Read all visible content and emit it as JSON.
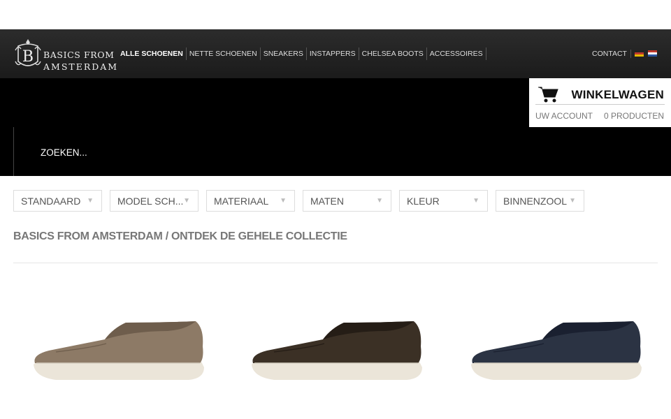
{
  "brand": {
    "line1": "BASICS FROM",
    "line2": "AMSTERDAM",
    "monogram": "B"
  },
  "nav": {
    "items": [
      {
        "label": "ALLE SCHOENEN",
        "active": true
      },
      {
        "label": "NETTE SCHOENEN"
      },
      {
        "label": "SNEAKERS"
      },
      {
        "label": "INSTAPPERS"
      },
      {
        "label": "CHELSEA BOOTS"
      },
      {
        "label": "ACCESSOIRES"
      }
    ],
    "contact": "CONTACT",
    "flags": [
      "german-flag-icon",
      "dutch-flag-icon"
    ]
  },
  "cart": {
    "title": "WINKELWAGEN",
    "account": "UW ACCOUNT",
    "count": "0 PRODUCTEN",
    "icon": "cart-icon"
  },
  "search": {
    "placeholder": "ZOEKEN..."
  },
  "filters": [
    {
      "label": "STANDAARD"
    },
    {
      "label": "MODEL SCH..."
    },
    {
      "label": "MATERIAAL"
    },
    {
      "label": "MATEN"
    },
    {
      "label": "KLEUR"
    },
    {
      "label": "BINNENZOOL"
    }
  ],
  "breadcrumb": "BASICS FROM AMSTERDAM / ONTDEK DE GEHELE COLLECTIE",
  "products": [
    {
      "color": "#8d7a66",
      "dark": "#6e5d4c"
    },
    {
      "color": "#3b3025",
      "dark": "#251d16"
    },
    {
      "color": "#2b3343",
      "dark": "#1a2030"
    }
  ],
  "colors": {
    "nav_bg": "#1e1e1e",
    "band": "#000000",
    "sole": "#ebe5d9"
  }
}
